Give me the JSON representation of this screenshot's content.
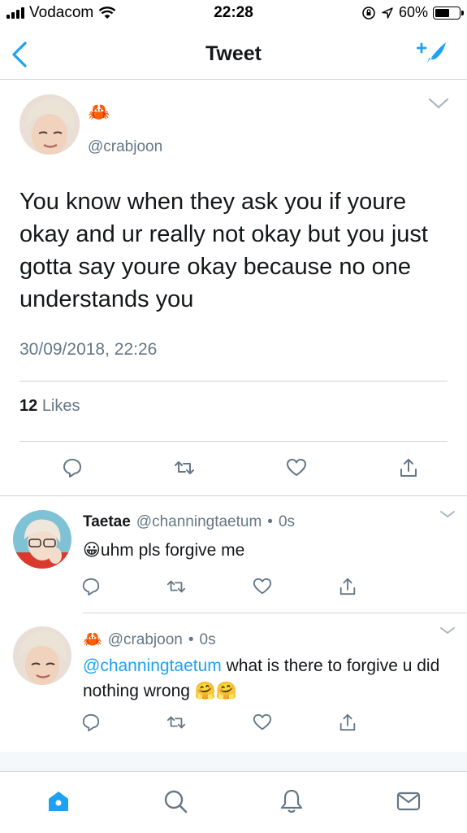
{
  "status_bar": {
    "carrier": "Vodacom",
    "time": "22:28",
    "battery_percent": "60%",
    "battery_level": 0.6
  },
  "nav": {
    "title": "Tweet",
    "back_icon": "chevron-left-icon",
    "compose_icon": "compose-tweet-icon"
  },
  "main_tweet": {
    "name": "🦀",
    "handle": "@crabjoon",
    "text": "You know when they ask you if youre okay and ur really not okay but you just gotta say youre okay because no one understands you",
    "timestamp": "30/09/2018, 22:26",
    "likes_count": "12",
    "likes_label": "Likes"
  },
  "replies": [
    {
      "name": "Taetae",
      "handle": "@channingtaetum",
      "dot": "•",
      "time": "0s",
      "emoji": "😀",
      "text": "uhm pls forgive me"
    },
    {
      "name": "🦀",
      "handle": "@crabjoon",
      "dot": "•",
      "time": "0s",
      "mention": "@channingtaetum",
      "text": " what is there to forgive u did nothing wrong ",
      "emoji_tail": "🤗🤗"
    }
  ],
  "colors": {
    "accent": "#1da1f2",
    "secondary_text": "#657786",
    "divider": "#d0d5d9"
  },
  "tabs": [
    "home-icon",
    "search-icon",
    "notifications-icon",
    "messages-icon"
  ]
}
